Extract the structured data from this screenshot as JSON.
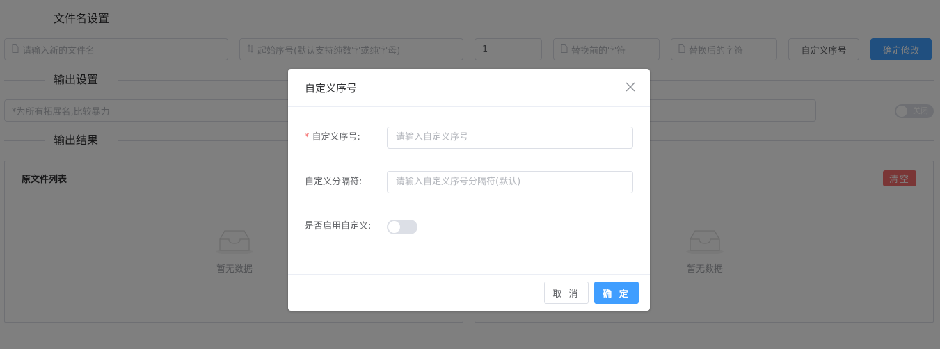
{
  "sections": {
    "filename_settings": "文件名设置",
    "output_settings": "输出设置",
    "output_results": "输出结果"
  },
  "toolbar": {
    "new_filename_placeholder": "请输入新的文件名",
    "start_index_placeholder": "起始序号(默认支持纯数字或纯字母)",
    "start_index_value": "1",
    "replace_before_placeholder": "替换前的字符",
    "replace_after_placeholder": "替换后的字符",
    "custom_index_button": "自定义序号",
    "confirm_button": "确定修改"
  },
  "output": {
    "extension_placeholder": "*为所有拓展名,比较暴力",
    "toggle_label": "关闭"
  },
  "panels": {
    "left_title": "原文件列表",
    "clear_button": "清空",
    "empty_text": "暂无数据"
  },
  "dialog": {
    "title": "自定义序号",
    "required_mark": "*",
    "custom_index_label": "自定义序号:",
    "custom_index_placeholder": "请输入自定义序号",
    "separator_label": "自定义分隔符:",
    "separator_placeholder": "请输入自定义序号分隔符(默认)",
    "enable_label": "是否启用自定义:",
    "cancel_button": "取 消",
    "ok_button": "确 定"
  },
  "colors": {
    "primary": "#409eff",
    "danger": "#f56c6c",
    "mask": "rgba(0,0,0,0.5)"
  },
  "icons": [
    "file-icon",
    "sort-icon",
    "close-icon",
    "empty-box-icon"
  ]
}
